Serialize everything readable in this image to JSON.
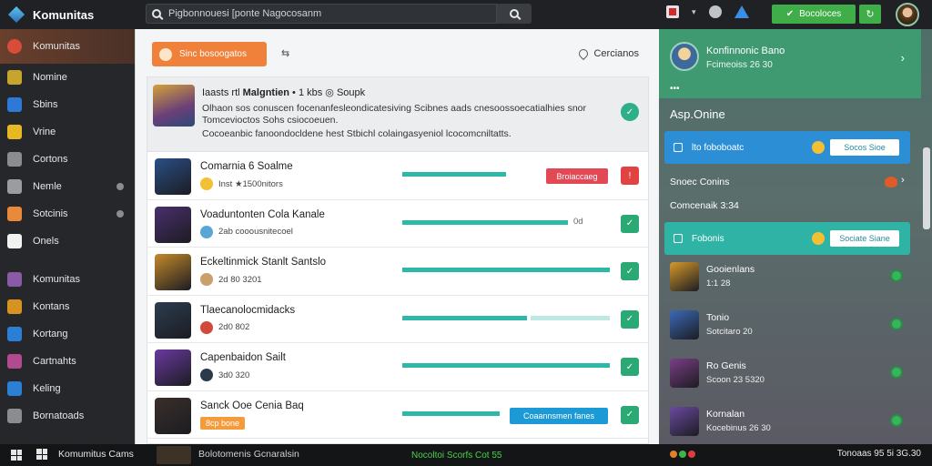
{
  "app": {
    "title": "Komunitas"
  },
  "search": {
    "value": "Pigbonnouesi [ponte Nagocosanm"
  },
  "header": {
    "action_button": "Bocoloces"
  },
  "sidebar": {
    "active": "Komunitas",
    "group1": [
      {
        "label": "Nomine",
        "color": "#c7a52a"
      },
      {
        "label": "Sbins",
        "color": "#2e78d6"
      },
      {
        "label": "Vrine",
        "color": "#e7b821"
      },
      {
        "label": "Cortons",
        "color": "#8a8d90"
      },
      {
        "label": "Nemle",
        "color": "#9a9da0",
        "dot": true
      },
      {
        "label": "Sotcinis",
        "color": "#e88a3a",
        "dot": true
      },
      {
        "label": "Onels",
        "color": "#f2f2f2"
      }
    ],
    "group2": [
      {
        "label": "Komunitas",
        "color": "#8b5aa7"
      },
      {
        "label": "Kontans",
        "color": "#d6931f"
      },
      {
        "label": "Kortang",
        "color": "#2b7fd4"
      },
      {
        "label": "Cartnahts",
        "color": "#b14a8f"
      },
      {
        "label": "Keling",
        "color": "#2b7fd4"
      },
      {
        "label": "Bornatoads",
        "color": "#8a8d90"
      }
    ]
  },
  "main": {
    "primary_button": "Sinc bosoogatos",
    "cancel_link": "Cercianos",
    "featured": {
      "title_prefix": "Iaasts rtl",
      "title_bold": "Malgntien",
      "title_suffix": "• 1 kbs ◎ Soupk",
      "text1": "Olhaon sos conuscen focenanfesleondicatesiving Scibnes aads cnesoossoecatialhies snor Tomcevioctos Sohs csiocoeuen.",
      "text2": "Cocoeanbic fanoondocldene hest Stbichl colaingasyeniol lcocomcniltatts."
    },
    "rows": [
      {
        "title": "Comarnia 6 Soalme",
        "meta": "Inst ★1500nitors",
        "tag": "",
        "progress": 0.5,
        "pill": "Broiaccaeg",
        "pill_type": "red",
        "status": "red"
      },
      {
        "title": "Voaduntonten Cola Kanale",
        "meta": "2ab cooousnitecoel",
        "tag": "",
        "progress": 0.8,
        "extra": "0d",
        "status": "green"
      },
      {
        "title": "Eckeltinmick Stanlt Santslo",
        "meta": "2d 80 3201",
        "tag": "",
        "progress": 1.0,
        "status": "green"
      },
      {
        "title": "Tlaecanolocmidacks",
        "meta": "2d0 802",
        "tag": "",
        "progress": 0.6,
        "status": "green"
      },
      {
        "title": "Capenbaidon Sailt",
        "meta": "3d0 320",
        "tag": "",
        "progress": 1.0,
        "status": "green"
      },
      {
        "title": "Sanck Ooe Cenia Baq",
        "meta": "",
        "tag": "8cp bone",
        "progress": 0.47,
        "pill": "Coaannsmen fanes",
        "pill_type": "blue",
        "status": "green"
      }
    ]
  },
  "right": {
    "profile_name": "Konfinnonic Bano",
    "profile_sub": "Fcimeoiss 26 30",
    "dots": "•••",
    "section": "Asp.Onine",
    "bar1": {
      "label": "lto foboboatc",
      "button": "Socos Sioe"
    },
    "line1": "Snoec Conins",
    "line2": "Comcenaik 3:34",
    "bar2": {
      "label": "Fobonis",
      "button": "Sociate Siane"
    },
    "friends": [
      {
        "name": "Gooienlans",
        "sub": "1:1 28",
        "color": "#d69a2a"
      },
      {
        "name": "Tonio",
        "sub": "Sotcitaro 20",
        "color": "#3a6ab8"
      },
      {
        "name": "Ro Genis",
        "sub": "Scoon 23 5320",
        "color": "#7b3e86"
      },
      {
        "name": "Kornalan",
        "sub": "Kocebinus 26 30",
        "color": "#6b4aa1"
      }
    ],
    "accent": "#2fa7c4"
  },
  "taskbar": {
    "app": "Komumitus Cams",
    "mid": "Bolotomenis Gcnaralsin",
    "green": "Nocoltoi Scorfs Cot 55",
    "right": "Tonoaas 95 5i 3G.30"
  }
}
